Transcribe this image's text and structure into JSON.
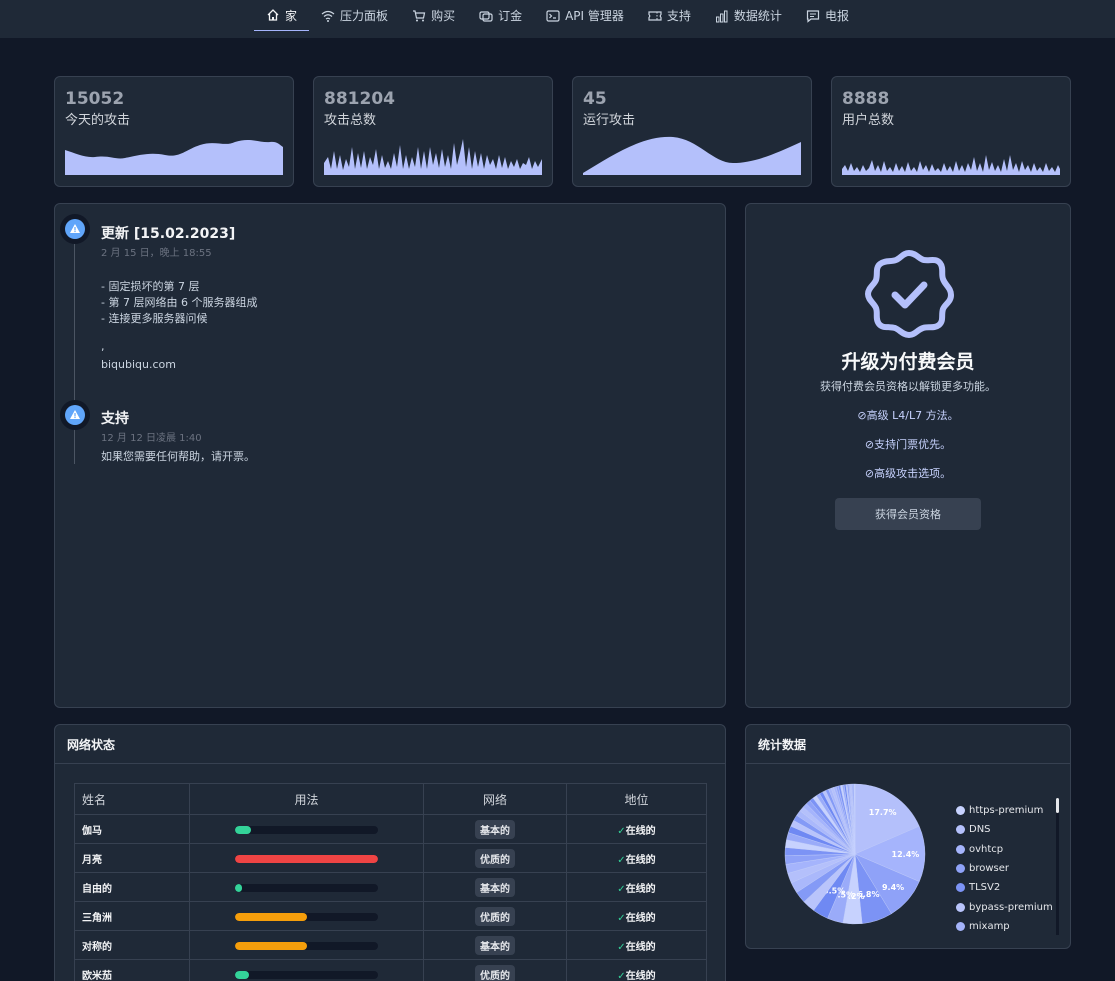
{
  "nav": [
    {
      "label": "家",
      "icon": "home-icon",
      "active": true
    },
    {
      "label": "压力面板",
      "icon": "wifi-icon"
    },
    {
      "label": "购买",
      "icon": "cart-icon"
    },
    {
      "label": "订金",
      "icon": "coins-icon"
    },
    {
      "label": "API 管理器",
      "icon": "terminal-icon"
    },
    {
      "label": "支持",
      "icon": "ticket-icon"
    },
    {
      "label": "数据统计",
      "icon": "chart-icon"
    },
    {
      "label": "电报",
      "icon": "message-icon"
    }
  ],
  "stats": [
    {
      "value": "15052",
      "label": "今天的攻击"
    },
    {
      "value": "881204",
      "label": "攻击总数"
    },
    {
      "value": "45",
      "label": "运行攻击"
    },
    {
      "value": "8888",
      "label": "用户总数"
    }
  ],
  "news": [
    {
      "title": "更新 [15.02.2023]",
      "date": "2 月 15 日，晚上 18:55",
      "lines": [
        "- 固定损坏的第 7 层",
        "- 第 7 层网络由 6 个服务器组成",
        "- 连接更多服务器问候",
        ",",
        "biqubiqu.com"
      ]
    },
    {
      "title": "支持",
      "date": "12 月 12 日凌晨 1:40",
      "lines": [
        "如果您需要任何帮助，请开票。"
      ]
    }
  ],
  "premium": {
    "title": "升级为付费会员",
    "subtitle": "获得付费会员资格以解锁更多功能。",
    "features": [
      "高级 L4/L7 方法。",
      "支持门票优先。",
      "高级攻击选项。"
    ],
    "button": "获得会员资格"
  },
  "network": {
    "title": "网络状态",
    "columns": [
      "姓名",
      "用法",
      "网络",
      "地位"
    ],
    "rows": [
      {
        "name": "伽马",
        "usage": 0.11,
        "color": "#34d399",
        "network": "基本的",
        "status": "在线的"
      },
      {
        "name": "月亮",
        "usage": 1.0,
        "color": "#ef4444",
        "network": "优质的",
        "status": "在线的"
      },
      {
        "name": "自由的",
        "usage": 0.05,
        "color": "#34d399",
        "network": "基本的",
        "status": "在线的"
      },
      {
        "name": "三角洲",
        "usage": 0.5,
        "color": "#f59e0b",
        "network": "优质的",
        "status": "在线的"
      },
      {
        "name": "对称的",
        "usage": 0.5,
        "color": "#f59e0b",
        "network": "基本的",
        "status": "在线的"
      },
      {
        "name": "欧米茄",
        "usage": 0.1,
        "color": "#34d399",
        "network": "优质的",
        "status": "在线的"
      }
    ]
  },
  "statistics": {
    "title": "统计数据",
    "legend": [
      {
        "label": "https-premium",
        "color": "#c7d2fe"
      },
      {
        "label": "DNS",
        "color": "#b4c0fb"
      },
      {
        "label": "ovhtcp",
        "color": "#a5b4fc"
      },
      {
        "label": "browser",
        "color": "#8fa2f8"
      },
      {
        "label": "TLSV2",
        "color": "#7c93f5"
      },
      {
        "label": "bypass-premium",
        "color": "#b9c4fb"
      },
      {
        "label": "mixamp",
        "color": "#a4b3f9"
      }
    ]
  },
  "chart_data": {
    "type": "pie",
    "labels": [
      "17.7%",
      "12.4%",
      "9.4%",
      "6.8%",
      "4.2%",
      "3.5%",
      "3.5%"
    ],
    "values": [
      17.7,
      12.4,
      9.4,
      6.8,
      4.2,
      3.5,
      3.5,
      2.8,
      2.6,
      2.4,
      2.2,
      2.0,
      1.9,
      1.8,
      1.7,
      1.6,
      1.5,
      1.4,
      1.3,
      1.2,
      1.1,
      1.0,
      1.0,
      0.9,
      0.9,
      0.8,
      0.8,
      0.7,
      0.7,
      0.6,
      0.6,
      0.5,
      0.5,
      0.5,
      0.4,
      0.4,
      0.4,
      0.3,
      0.3,
      0.3,
      0.3,
      0.2,
      0.2,
      0.2,
      0.2
    ]
  }
}
